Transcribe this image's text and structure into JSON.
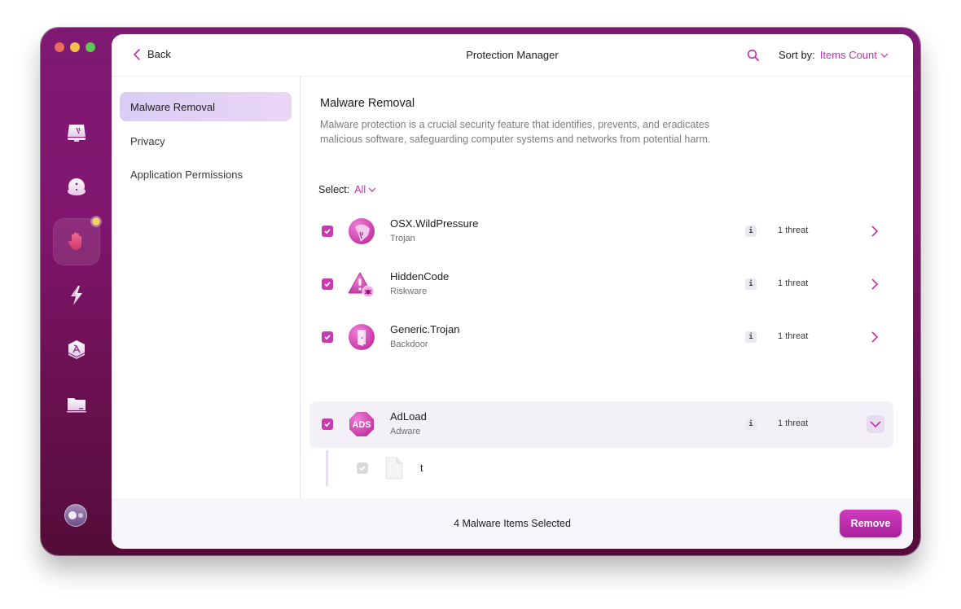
{
  "window": {
    "traffic_lights": [
      "close",
      "minimize",
      "zoom"
    ]
  },
  "rail": {
    "items": [
      {
        "icon": "cleanup-monitor-icon",
        "label": "Cleanup"
      },
      {
        "icon": "protection-disc-icon",
        "label": "Protection"
      },
      {
        "icon": "hand-stop-icon",
        "label": "Protection Manager",
        "active": true,
        "badge": true
      },
      {
        "icon": "lightning-speed-icon",
        "label": "Performance"
      },
      {
        "icon": "applications-icon",
        "label": "Applications"
      },
      {
        "icon": "folder-icon",
        "label": "Files"
      }
    ],
    "assistant_icon": "assistant-icon"
  },
  "topbar": {
    "back_label": "Back",
    "title": "Protection Manager",
    "sort_label": "Sort by:",
    "sort_value": "Items Count"
  },
  "sidebar": {
    "items": [
      {
        "label": "Malware Removal",
        "active": true
      },
      {
        "label": "Privacy"
      },
      {
        "label": "Application Permissions"
      }
    ]
  },
  "content": {
    "title": "Malware Removal",
    "description": "Malware protection is a crucial security feature that identifies, prevents, and eradicates malicious software, safeguarding computer systems and networks from potential harm.",
    "select_label": "Select:",
    "select_value": "All",
    "threats": [
      {
        "name": "OSX.WildPressure",
        "type": "Trojan",
        "count": "1 threat",
        "checked": true,
        "expanded": false,
        "icon": "trojan-horse-icon"
      },
      {
        "name": "HiddenCode",
        "type": "Riskware",
        "count": "1 threat",
        "checked": true,
        "expanded": false,
        "icon": "warning-bug-icon"
      },
      {
        "name": "Generic.Trojan",
        "type": "Backdoor",
        "count": "1 threat",
        "checked": true,
        "expanded": false,
        "icon": "backdoor-door-icon"
      },
      {
        "name": "AdLoad",
        "type": "Adware",
        "count": "1 threat",
        "checked": true,
        "expanded": true,
        "icon": "ads-stop-icon",
        "icon_text": "ADS"
      }
    ],
    "info_glyph": "i",
    "expanded_items": [
      {
        "name": "t",
        "checked": true,
        "disabled": true
      }
    ]
  },
  "footer": {
    "status": "4 Malware Items Selected",
    "remove_label": "Remove"
  },
  "colors": {
    "accent": "#c12fb1",
    "checkbox": "#c73ab0",
    "window_top": "#7e1a73",
    "window_bottom": "#540c38",
    "sidebar_active": "#ddd0f4"
  }
}
